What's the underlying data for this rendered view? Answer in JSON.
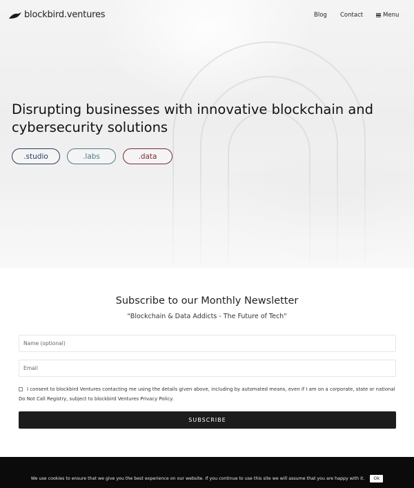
{
  "header": {
    "brand": "blockbird.ventures",
    "nav": {
      "blog": "Blog",
      "contact": "Contact",
      "menu": "Menu"
    }
  },
  "hero": {
    "headline": "Disrupting businesses with innovative blockchain and cybersecurity solutions",
    "pills": {
      "studio": ".studio",
      "labs": ".labs",
      "data": ".data"
    },
    "colors": {
      "studio": "#2b3b66",
      "labs": "#4d7a86",
      "data": "#7a2a36"
    }
  },
  "newsletter": {
    "title": "Subscribe to our Monthly Newsletter",
    "quote": "\"Blockchain & Data Addicts - The Future of Tech\"",
    "name_placeholder": "Name (optional)",
    "email_placeholder": "Email",
    "consent": "I consent to blockbird Ventures contacting me using the details given above, including by automated means, even if I am on a corporate, state or national Do Not Call Registry, subject to blockbird Ventures Privacy Policy.",
    "subscribe_label": "SUBSCRIBE"
  },
  "cookie": {
    "text": "We use cookies to ensure that we give you the best experience on our website. If you continue to use this site we will assume that you are happy with it.",
    "ok_label": "Ok"
  }
}
